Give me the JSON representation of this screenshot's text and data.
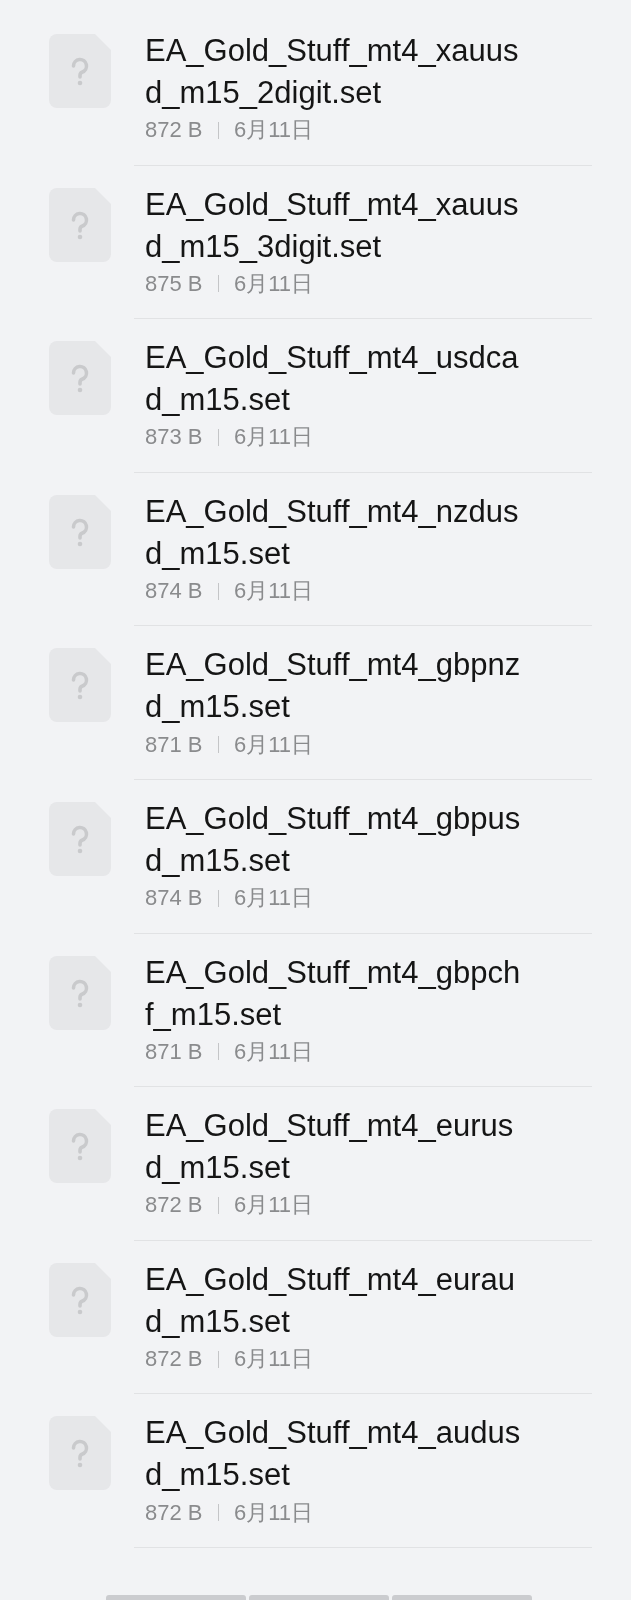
{
  "files": [
    {
      "name": "EA_Gold_Stuff_mt4_xauusd_m15_2digit.set",
      "size": "872 B",
      "date": "6月11日"
    },
    {
      "name": "EA_Gold_Stuff_mt4_xauusd_m15_3digit.set",
      "size": "875 B",
      "date": "6月11日"
    },
    {
      "name": "EA_Gold_Stuff_mt4_usdcad_m15.set",
      "size": "873 B",
      "date": "6月11日"
    },
    {
      "name": "EA_Gold_Stuff_mt4_nzdusd_m15.set",
      "size": "874 B",
      "date": "6月11日"
    },
    {
      "name": "EA_Gold_Stuff_mt4_gbpnzd_m15.set",
      "size": "871 B",
      "date": "6月11日"
    },
    {
      "name": "EA_Gold_Stuff_mt4_gbpusd_m15.set",
      "size": "874 B",
      "date": "6月11日"
    },
    {
      "name": "EA_Gold_Stuff_mt4_gbpchf_m15.set",
      "size": "871 B",
      "date": "6月11日"
    },
    {
      "name": "EA_Gold_Stuff_mt4_eurusd_m15.set",
      "size": "872 B",
      "date": "6月11日"
    },
    {
      "name": "EA_Gold_Stuff_mt4_euraud_m15.set",
      "size": "872 B",
      "date": "6月11日"
    },
    {
      "name": "EA_Gold_Stuff_mt4_audusd_m15.set",
      "size": "872 B",
      "date": "6月11日"
    }
  ]
}
